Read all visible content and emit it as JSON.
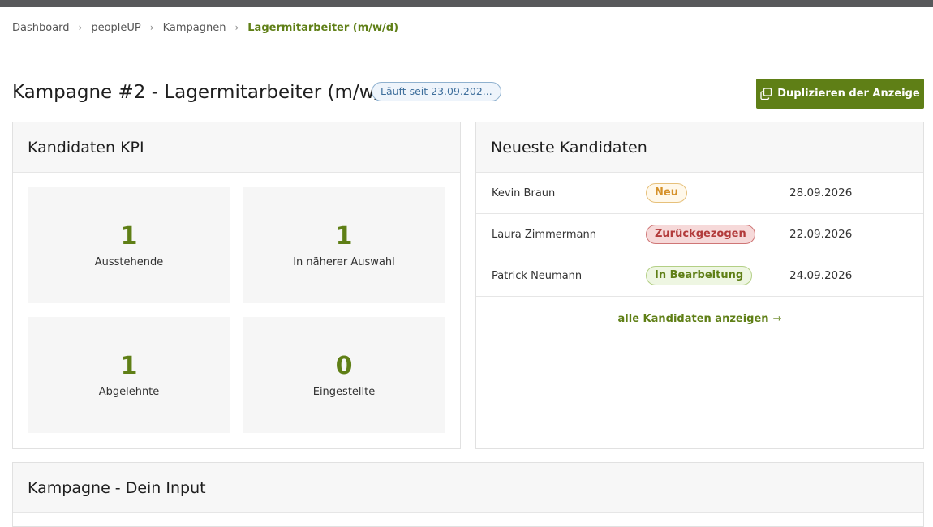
{
  "breadcrumb": {
    "items": [
      "Dashboard",
      "peopleUP",
      "Kampagnen"
    ],
    "current": "Lagermitarbeiter (m/w/d)",
    "separator": "›"
  },
  "header": {
    "title": "Kampagne #2 - Lagermitarbeiter (m/w/d)",
    "status_badge": "Läuft seit 23.09.202...",
    "duplicate_button": "Duplizieren der Anzeige",
    "duplicate_icon": "copy-icon"
  },
  "kpi": {
    "title": "Kandidaten KPI",
    "tiles": [
      {
        "value": "1",
        "label": "Ausstehende"
      },
      {
        "value": "1",
        "label": "In näherer Auswahl"
      },
      {
        "value": "1",
        "label": "Abgelehnte"
      },
      {
        "value": "0",
        "label": "Eingestellte"
      }
    ]
  },
  "candidates": {
    "title": "Neueste Kandidaten",
    "rows": [
      {
        "name": "Kevin Braun",
        "status": "Neu",
        "date": "28.09.2026"
      },
      {
        "name": "Laura Zimmermann",
        "status": "Zurückgezogen",
        "date": "22.09.2026"
      },
      {
        "name": "Patrick Neumann",
        "status": "In Bearbeitung",
        "date": "24.09.2026"
      }
    ],
    "all_link": "alle Kandidaten anzeigen",
    "all_link_arrow": "→"
  },
  "input_section": {
    "title": "Kampagne - Dein Input"
  },
  "colors": {
    "accent": "#5f7f16",
    "topbar": "#58595b"
  }
}
